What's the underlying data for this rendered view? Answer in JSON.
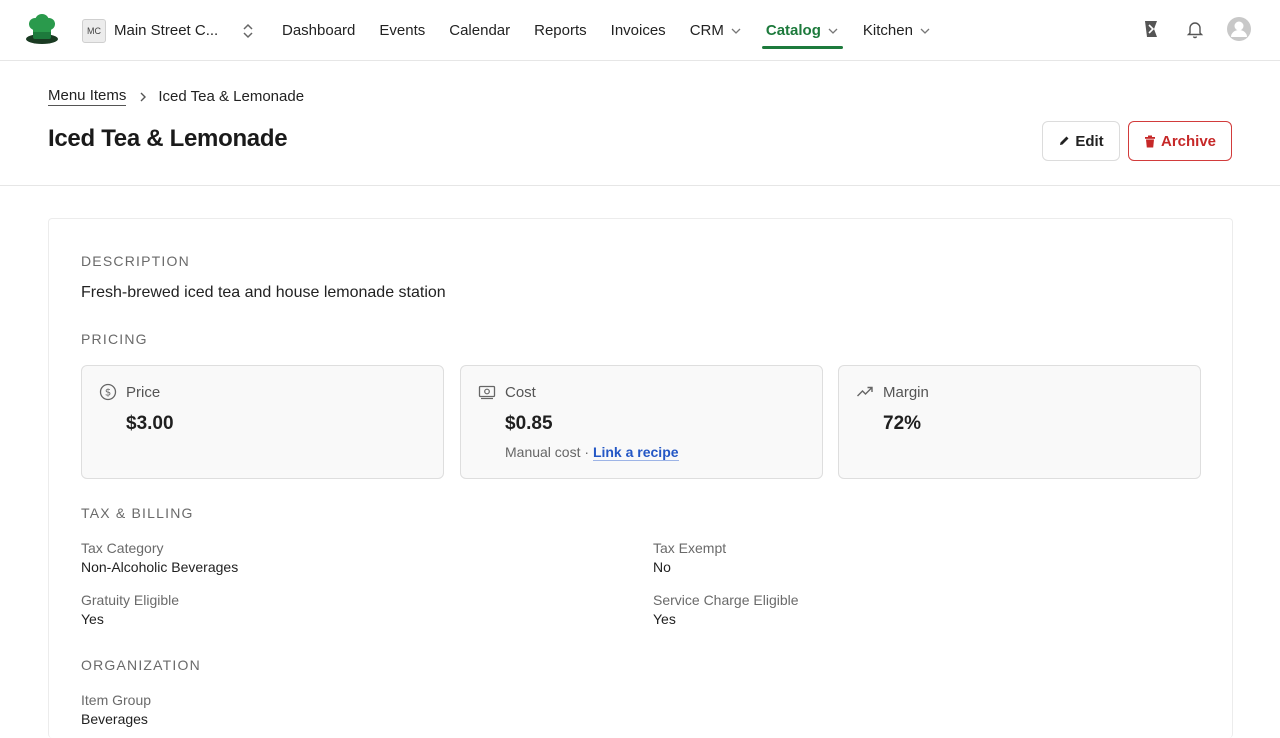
{
  "nav": {
    "org_badge": "MC",
    "org_name": "Main Street C...",
    "links": [
      {
        "label": "Dashboard"
      },
      {
        "label": "Events"
      },
      {
        "label": "Calendar"
      },
      {
        "label": "Reports"
      },
      {
        "label": "Invoices"
      },
      {
        "label": "CRM"
      },
      {
        "label": "Catalog"
      },
      {
        "label": "Kitchen"
      }
    ],
    "active": "Catalog",
    "accent_color": "#1d7a3c",
    "right_icons": [
      "feedback-icon",
      "bell-icon",
      "avatar"
    ]
  },
  "breadcrumb": {
    "parent": "Menu Items",
    "current": "Iced Tea & Lemonade"
  },
  "page": {
    "title": "Iced Tea & Lemonade",
    "edit_label": "Edit",
    "archive_label": "Archive",
    "danger_color": "#c62828"
  },
  "sections": {
    "description": {
      "label": "DESCRIPTION",
      "text": "Fresh-brewed iced tea and house lemonade station"
    },
    "pricing": {
      "label": "PRICING",
      "price": {
        "label": "Price",
        "value": "$3.00",
        "icon": "dollar-circle-icon"
      },
      "cost": {
        "label": "Cost",
        "value": "$0.85",
        "note": "Manual cost ·",
        "link": "Link a recipe",
        "icon": "cash-icon"
      },
      "margin": {
        "label": "Margin",
        "value": "72%",
        "icon": "trending-up-icon"
      }
    },
    "tax": {
      "label": "TAX & BILLING",
      "tax_category": {
        "label": "Tax Category",
        "value": "Non-Alcoholic Beverages"
      },
      "tax_exempt": {
        "label": "Tax Exempt",
        "value": "No"
      },
      "gratuity": {
        "label": "Gratuity Eligible",
        "value": "Yes"
      },
      "service_charge": {
        "label": "Service Charge Eligible",
        "value": "Yes"
      }
    },
    "organization": {
      "label": "ORGANIZATION",
      "item_group": {
        "label": "Item Group",
        "value": "Beverages"
      }
    }
  }
}
